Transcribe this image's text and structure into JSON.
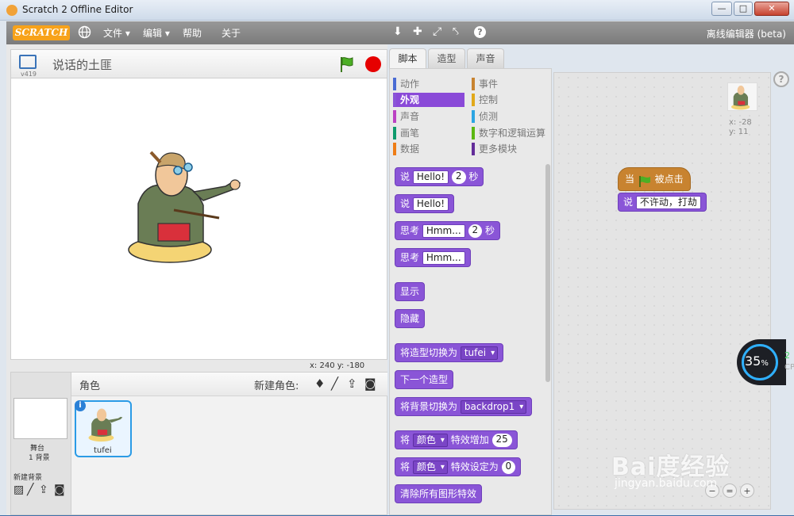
{
  "window": {
    "title": "Scratch 2 Offline Editor",
    "minimize": "—",
    "maximize": "□",
    "close": "✕"
  },
  "menubar": {
    "logo": "SCRATCH",
    "menus": [
      "文件 ▾",
      "编辑 ▾",
      "帮助",
      "关于"
    ],
    "tools": [
      "⬇",
      "✚",
      "⤢",
      "⤣",
      "?"
    ],
    "right_label": "离线编辑器 (beta)"
  },
  "stage": {
    "version": "v419",
    "project_name": "说话的土匪",
    "coords": "x: 240  y: -180"
  },
  "sprites": {
    "header_label": "角色",
    "new_sprite_label": "新建角色:",
    "stage_label": "舞台",
    "backdrop_count": "1 背景",
    "new_backdrop_label": "新建背景",
    "sprite_name": "tufei",
    "info": "i"
  },
  "tabs": [
    "脚本",
    "造型",
    "声音"
  ],
  "categories": [
    {
      "label": "动作",
      "color": "#4a6cd4"
    },
    {
      "label": "外观",
      "color": "#8a55d7"
    },
    {
      "label": "声音",
      "color": "#bb42c3"
    },
    {
      "label": "画笔",
      "color": "#0e9a6c"
    },
    {
      "label": "数据",
      "color": "#ee7d16"
    },
    {
      "label": "事件",
      "color": "#c88330"
    },
    {
      "label": "控制",
      "color": "#e1a91a"
    },
    {
      "label": "侦测",
      "color": "#2ca5e2"
    },
    {
      "label": "数字和逻辑运算",
      "color": "#5cb712"
    },
    {
      "label": "更多模块",
      "color": "#632d99"
    }
  ],
  "blocks": {
    "b1": {
      "a": "说",
      "s": "Hello!",
      "n": "2",
      "b": "秒"
    },
    "b2": {
      "a": "说",
      "s": "Hello!"
    },
    "b3": {
      "a": "思考",
      "s": "Hmm...",
      "n": "2",
      "b": "秒"
    },
    "b4": {
      "a": "思考",
      "s": "Hmm..."
    },
    "b5": {
      "a": "显示"
    },
    "b6": {
      "a": "隐藏"
    },
    "b7": {
      "a": "将造型切换为",
      "d": "tufei"
    },
    "b8": {
      "a": "下一个造型"
    },
    "b9": {
      "a": "将背景切换为",
      "d": "backdrop1"
    },
    "b10": {
      "a": "将",
      "d": "颜色",
      "b": "特效增加",
      "n": "25"
    },
    "b11": {
      "a": "将",
      "d": "颜色",
      "b": "特效设定为",
      "n": "0"
    },
    "b12": {
      "a": "清除所有图形特效"
    }
  },
  "script": {
    "hat_before": "当",
    "hat_after": "被点击",
    "say_label": "说",
    "say_text": "不许动，打劫",
    "sprite_x": "x: -28",
    "sprite_y": "y: 11"
  },
  "help": "?",
  "cpu": {
    "percent": "35",
    "unit": "%",
    "side_value": "2",
    "side_label": "CP"
  },
  "watermark": {
    "line1": "Bai度经验",
    "line2": "jingyan.baidu.com"
  }
}
